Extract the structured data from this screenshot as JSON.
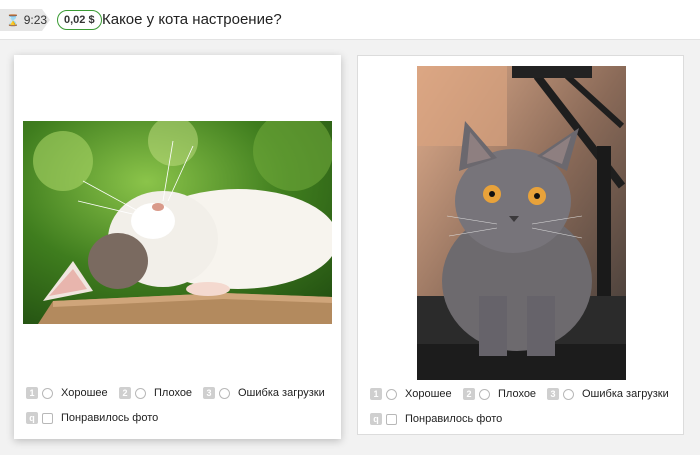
{
  "header": {
    "timer": "9:23",
    "price": "0,02 $",
    "question": "Какое у кота настроение?"
  },
  "cards": [
    {
      "options": [
        {
          "key": "1",
          "label": "Хорошее"
        },
        {
          "key": "2",
          "label": "Плохое"
        },
        {
          "key": "3",
          "label": "Ошибка загрузки"
        }
      ],
      "checkbox": {
        "key": "q",
        "label": "Понравилось фото"
      }
    },
    {
      "options": [
        {
          "key": "1",
          "label": "Хорошее"
        },
        {
          "key": "2",
          "label": "Плохое"
        },
        {
          "key": "3",
          "label": "Ошибка загрузки"
        }
      ],
      "checkbox": {
        "key": "q",
        "label": "Понравилось фото"
      }
    }
  ],
  "colors": {
    "price_border": "#3a9b33",
    "background": "#f2f2f2"
  }
}
